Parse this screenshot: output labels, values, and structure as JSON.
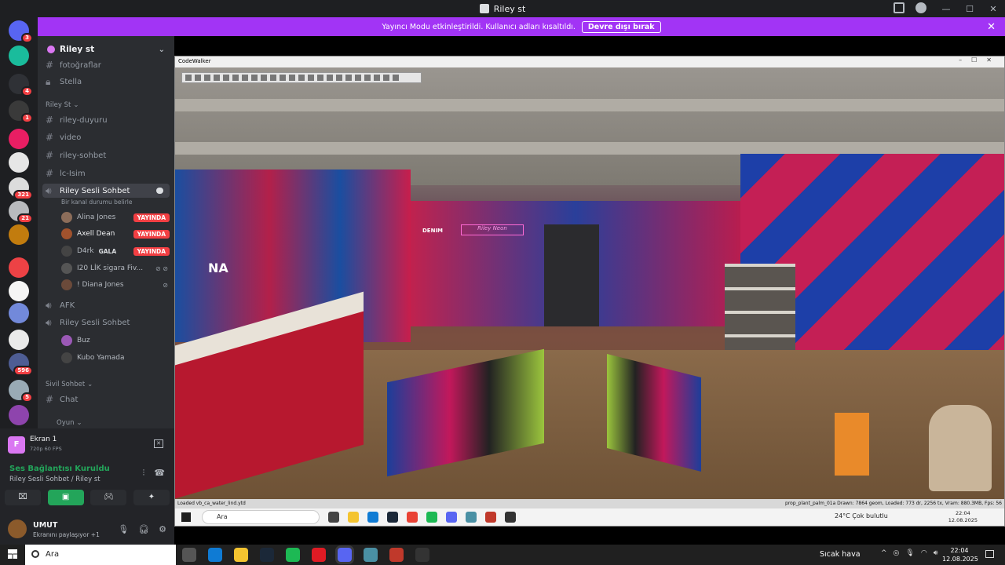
{
  "window": {
    "title": "Riley st"
  },
  "banner": {
    "message": "Yayıncı Modu etkinleştirildi. Kullanıcı adları kısaltıldı.",
    "button": "Devre dışı bırak",
    "close": "✕"
  },
  "guilds": [
    {
      "badge": "3",
      "color": "#5865f2"
    },
    {
      "badge": "",
      "color": "#1abc9c"
    },
    {
      "badge": "4",
      "color": "#2f3136"
    },
    {
      "badge": "1",
      "color": "#3a3a3a"
    },
    {
      "badge": "",
      "color": "#e91e63"
    },
    {
      "badge": "",
      "color": "#e6e6e6"
    },
    {
      "badge": "321",
      "color": "#dcdcdc"
    },
    {
      "badge": "21",
      "color": "#b9bbbe"
    },
    {
      "badge": "",
      "color": "#c27c0e"
    },
    {
      "badge": "",
      "color": "#ed4245"
    },
    {
      "badge": "",
      "color": "#f5f5f5"
    },
    {
      "badge": "",
      "color": "#7289da"
    },
    {
      "badge": "",
      "color": "#eaeaea"
    },
    {
      "badge": "596",
      "color": "#4e5d94"
    },
    {
      "badge": "5",
      "color": "#99aab5"
    },
    {
      "badge": "",
      "color": "#8e44ad"
    }
  ],
  "sidebar": {
    "server_name": "Riley st",
    "channels_top": [
      "fotoğraflar",
      "Stella"
    ],
    "category_1": "Riley St",
    "channels": [
      "riley-duyuru",
      "video",
      "riley-sohbet",
      "lc-Isim"
    ],
    "voice_active": {
      "name": "Riley Sesli Sohbet",
      "status": "Bir kanal durumu belirle"
    },
    "voice_users": [
      {
        "name": "Alina Jones",
        "live": "YAYINDA",
        "color": "#8c6d5a"
      },
      {
        "name": "Axell Dean",
        "live": "YAYINDA",
        "color": "#a0522d"
      },
      {
        "name": "D4rk",
        "tag": "GALA",
        "live": "YAYINDA",
        "color": "#444"
      },
      {
        "name": "I20 LİK sigara Fiv...",
        "live": "",
        "color": "#555"
      },
      {
        "name": "! Diana Jones",
        "live": "",
        "color": "#6b4a3a"
      }
    ],
    "afk": "AFK",
    "voice_2": "Riley Sesli Sohbet",
    "voice_2_users": [
      {
        "name": "Buz",
        "color": "#9b59b6"
      },
      {
        "name": "Kubo Yamada",
        "color": "#444"
      }
    ],
    "category_2": "Sivil Sohbet",
    "chat": "Chat",
    "category_3": "Oyun"
  },
  "panel": {
    "screen_title": "Ekran 1",
    "screen_sub": "720p 60 FPS",
    "connection": "Ses Bağlantısı Kuruldu",
    "connection_sub": "Riley Sesli Sohbet / Riley st",
    "user": "UMUT",
    "user_status": "Ekranını paylaşıyor +1"
  },
  "stream": {
    "app_title": "CodeWalker",
    "status_left": "Loaded vb_ca_water_lind.ytd",
    "status_right": "prop_plant_palm_01a  Drawn: 7864 geom, Loaded: 773 dr, 2256 tx, Vram: 880.3MB, Fps: 56",
    "scene_sign": "NA",
    "scene_denim": "DENIM",
    "scene_neon": "Riley Neon",
    "inner_search": "Ara",
    "inner_weather": "24°C  Çok bulutlu",
    "inner_time": "22:04",
    "inner_date": "12.08.2025"
  },
  "taskbar": {
    "search": "Ara",
    "weather": "Sıcak hava",
    "time": "22:04",
    "date": "12.08.2025",
    "apps": [
      {
        "name": "task-view",
        "color": "#555"
      },
      {
        "name": "edge",
        "color": "#0f7bd4"
      },
      {
        "name": "explorer",
        "color": "#f4c430"
      },
      {
        "name": "steam",
        "color": "#1b2838"
      },
      {
        "name": "spotify",
        "color": "#1db954"
      },
      {
        "name": "opera",
        "color": "#e01b24"
      },
      {
        "name": "discord",
        "color": "#5865f2"
      },
      {
        "name": "app-teal",
        "color": "#4a90a4"
      },
      {
        "name": "app-red",
        "color": "#c0392b"
      },
      {
        "name": "app-dark",
        "color": "#333"
      }
    ]
  }
}
